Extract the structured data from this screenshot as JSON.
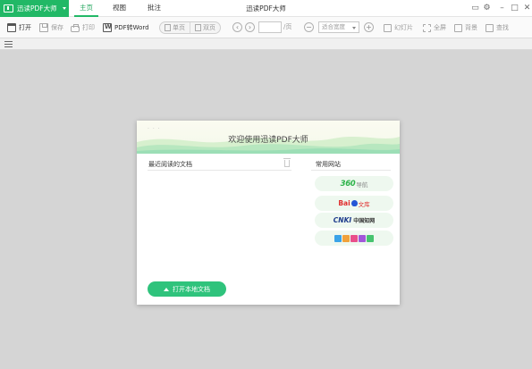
{
  "app": {
    "name": "迅读PDF大师",
    "window_title": "迅读PDF大师"
  },
  "tabs": [
    "主页",
    "视图",
    "批注"
  ],
  "toolbar": {
    "open": "打开",
    "save": "保存",
    "print": "打印",
    "pdf_to_word": "PDF转Word",
    "single_page": "单页",
    "double_page": "双页",
    "page_suffix": "/页",
    "zoom_value": "适合宽度",
    "slideshow": "幻灯片",
    "fullscreen": "全屏",
    "background": "背景",
    "find": "查找"
  },
  "welcome": {
    "title": "欢迎使用迅读PDF大师",
    "recent_label": "最近阅读的文档",
    "sites_label": "常用网站",
    "open_local": "打开本地文档",
    "sites": {
      "nav360": {
        "brand": "360",
        "suffix": "导航"
      },
      "baidu": {
        "brand": "Bai",
        "suffix": "文库"
      },
      "cnki": {
        "brand": "CNKI",
        "suffix": "中国知网"
      }
    }
  },
  "colors": {
    "accent": "#21b866",
    "button": "#2fc37c",
    "site_bg": "#eef8ef",
    "canvas": "#d5d5d5"
  }
}
